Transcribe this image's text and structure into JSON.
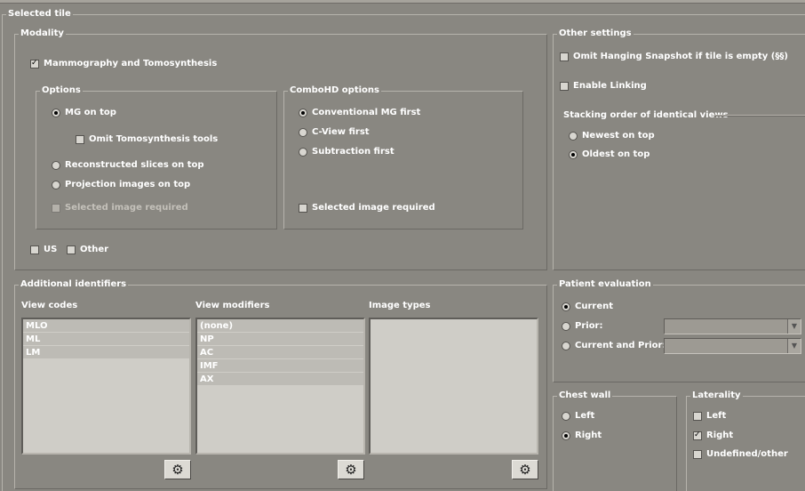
{
  "selected_tile": {
    "title": "Selected tile"
  },
  "modality": {
    "title": "Modality",
    "mammo_tomo": {
      "label": "Mammography and Tomosynthesis",
      "checked": true
    },
    "options": {
      "title": "Options",
      "mg_on_top": {
        "label": "MG on top",
        "selected": true
      },
      "omit_tomo_tools": {
        "label": "Omit Tomosynthesis tools",
        "checked": false
      },
      "recon_slices_on_top": {
        "label": "Reconstructed slices on top",
        "selected": false
      },
      "projection_on_top": {
        "label": "Projection images on top",
        "selected": false
      },
      "selected_image_required": {
        "label": "Selected image required",
        "checked": false,
        "disabled": true
      }
    },
    "combohd": {
      "title": "ComboHD options",
      "conventional_mg_first": {
        "label": "Conventional MG first",
        "selected": true
      },
      "cview_first": {
        "label": "C-View first",
        "selected": false
      },
      "subtraction_first": {
        "label": "Subtraction first",
        "selected": false
      },
      "selected_image_required": {
        "label": "Selected image required",
        "checked": false
      }
    },
    "us": {
      "label": "US",
      "checked": false
    },
    "other": {
      "label": "Other",
      "checked": false
    }
  },
  "other_settings": {
    "title": "Other settings",
    "omit_hanging_snapshot": {
      "label": "Omit Hanging Snapshot if tile is empty (§§)",
      "checked": false
    },
    "enable_linking": {
      "label": "Enable Linking",
      "checked": false
    },
    "stacking": {
      "title": "Stacking order of identical views",
      "newest_on_top": {
        "label": "Newest on top",
        "selected": false
      },
      "oldest_on_top": {
        "label": "Oldest on top",
        "selected": true
      }
    }
  },
  "additional_identifiers": {
    "title": "Additional identifiers",
    "view_codes": {
      "label": "View codes",
      "items": [
        "MLO",
        "ML",
        "LM"
      ]
    },
    "view_modifiers": {
      "label": "View modifiers",
      "items": [
        "(none)",
        "NP",
        "AC",
        "IMF",
        "AX"
      ]
    },
    "image_types": {
      "label": "Image types",
      "items": []
    },
    "settings_icon": "gear-icon"
  },
  "patient_evaluation": {
    "title": "Patient evaluation",
    "current": {
      "label": "Current",
      "selected": true
    },
    "prior": {
      "label": "Prior:",
      "selected": false,
      "value": ""
    },
    "current_and_prior": {
      "label": "Current and Prior:",
      "selected": false,
      "value": ""
    }
  },
  "chest_wall": {
    "title": "Chest wall",
    "left": {
      "label": "Left",
      "selected": false
    },
    "right": {
      "label": "Right",
      "selected": true
    }
  },
  "laterality": {
    "title": "Laterality",
    "left": {
      "label": "Left",
      "checked": false
    },
    "right": {
      "label": "Right",
      "checked": true
    },
    "undefined_other": {
      "label": "Undefined/other",
      "checked": false
    }
  },
  "colors": {
    "background": "#898781",
    "listbox": "#cfcdc7",
    "text": "#ffffff"
  }
}
